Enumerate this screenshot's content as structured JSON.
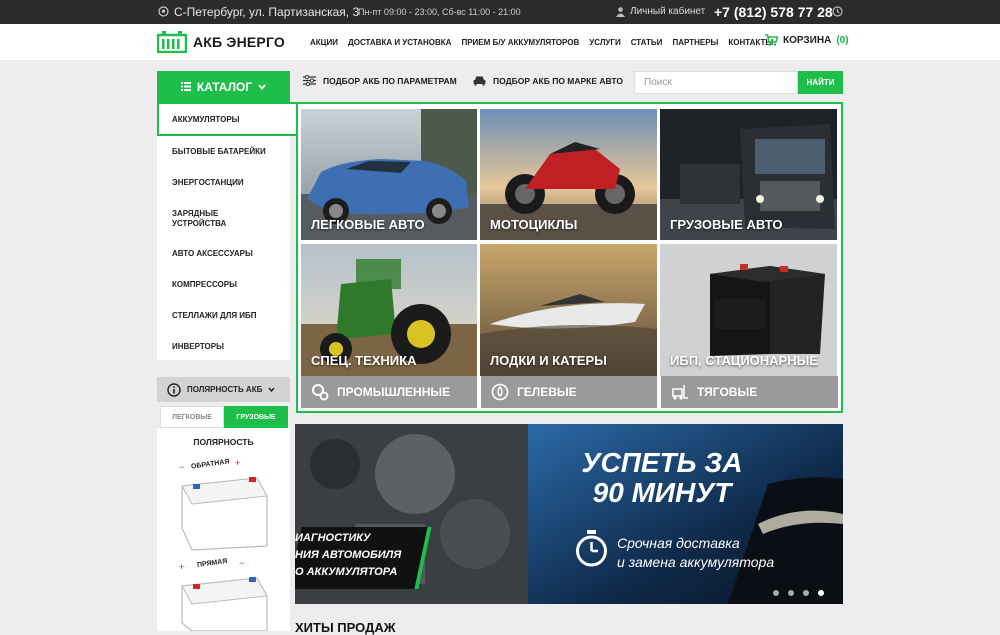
{
  "topbar": {
    "location": "С-Петербург, ул. Партизанская, 3",
    "hours": "Пн-пт 09:00 - 23:00, Сб-вс 11:00 - 21:00",
    "account": "Личный кабинет",
    "phone": "+7 (812) 578 77 28"
  },
  "header": {
    "logo": "АКБ ЭНЕРГО",
    "nav": [
      "АКЦИИ",
      "ДОСТАВКА И УСТАНОВКА",
      "ПРИЕМ Б/У АККУМУЛЯТОРОВ",
      "УСЛУГИ",
      "СТАТЬИ",
      "ПАРТНЕРЫ",
      "КОНТАКТЫ"
    ],
    "cart_label": "КОРЗИНА",
    "cart_count": "(0)"
  },
  "toolbar": {
    "catalog": "КАТАЛОГ",
    "pick_params": "ПОДБОР АКБ ПО ПАРАМЕТРАМ",
    "pick_brand": "ПОДБОР АКБ ПО МАРКЕ АВТО",
    "search_placeholder": "Поиск",
    "search_button": "НАЙТИ"
  },
  "sidebar": {
    "items": [
      "АККУМУЛЯТОРЫ",
      "БЫТОВЫЕ БАТАРЕЙКИ",
      "ЭНЕРГОСТАНЦИИ",
      "ЗАРЯДНЫЕ УСТРОЙСТВА",
      "АВТО АКСЕССУАРЫ",
      "КОМПРЕССОРЫ",
      "СТЕЛЛАЖИ ДЛЯ ИБП",
      "ИНВЕРТОРЫ"
    ]
  },
  "tiles": [
    "ЛЕГКОВЫЕ АВТО",
    "МОТОЦИКЛЫ",
    "ГРУЗОВЫЕ АВТО",
    "СПЕЦ. ТЕХНИКА",
    "ЛОДКИ И КАТЕРЫ",
    "ИБП, СТАЦИОНАРНЫЕ"
  ],
  "subcats": [
    "ПРОМЫШЛЕННЫЕ",
    "ГЕЛЕВЫЕ",
    "ТЯГОВЫЕ"
  ],
  "polarity": {
    "toggle": "ПОЛЯРНОСТЬ АКБ",
    "tab_light": "ЛЕГКОВЫЕ",
    "tab_truck": "ГРУЗОВЫЕ",
    "title": "ПОЛЯРНОСТЬ",
    "reverse": "ОБРАТНАЯ",
    "direct": "ПРЯМАЯ"
  },
  "banner": {
    "left_lines": [
      "ИАГНОСТИКУ",
      "НИЯ АВТОМОБИЛЯ",
      "О АККУМУЛЯТОРА"
    ],
    "headline1": "УСПЕТЬ ЗА",
    "headline2": "90 МИНУТ",
    "sub1": "Срочная доставка",
    "sub2": "и замена аккумулятора"
  },
  "hits": "ХИТЫ ПРОДАЖ",
  "colors": {
    "accent": "#1ebe4a",
    "dark": "#2b2b2b"
  }
}
